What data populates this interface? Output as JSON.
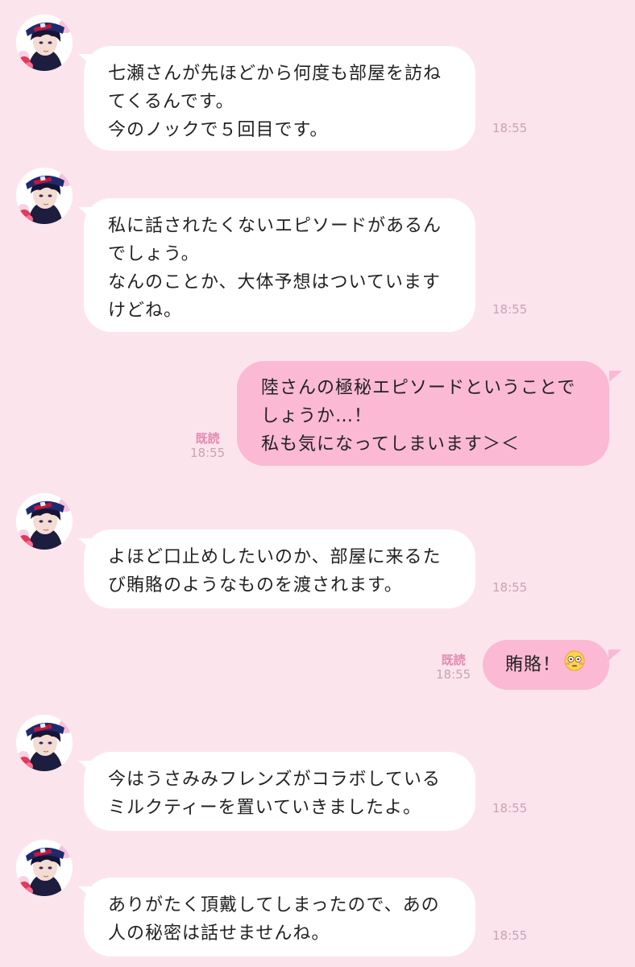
{
  "colors": {
    "background": "#fce4ed",
    "incoming_bubble": "#ffffff",
    "outgoing_bubble": "#fbb9d3",
    "read_label": "#e48ab0",
    "timestamp": "#c7a4b3"
  },
  "messages": [
    {
      "side": "incoming",
      "lines": [
        "七瀬さんが先ほどから何度も部屋を訪ね",
        "てくるんです。",
        "今のノックで５回目です。"
      ],
      "time": "18:55"
    },
    {
      "side": "incoming",
      "lines": [
        "私に話されたくないエピソードがあるん",
        "でしょう。",
        "なんのことか、大体予想はついています",
        "けどね。"
      ],
      "time": "18:55"
    },
    {
      "side": "outgoing",
      "lines": [
        "陸さんの極秘エピソードということで",
        "しょうか…！",
        "私も気になってしまいます＞＜"
      ],
      "read": "既読",
      "time": "18:55"
    },
    {
      "side": "incoming",
      "lines": [
        "よほど口止めしたいのか、部屋に来るた",
        "び賄賂のようなものを渡されます。"
      ],
      "time": "18:55"
    },
    {
      "side": "outgoing",
      "lines": [
        "賄賂！"
      ],
      "emoji": "flushed-face-emoji",
      "read": "既読",
      "time": "18:55"
    },
    {
      "side": "incoming",
      "lines": [
        "今はうさみみフレンズがコラボしている",
        "ミルクティーを置いていきましたよ。"
      ],
      "time": "18:55"
    },
    {
      "side": "incoming",
      "lines": [
        "ありがたく頂戴してしまったので、あの",
        "人の秘密は話せませんね。"
      ],
      "time": "18:55"
    }
  ]
}
